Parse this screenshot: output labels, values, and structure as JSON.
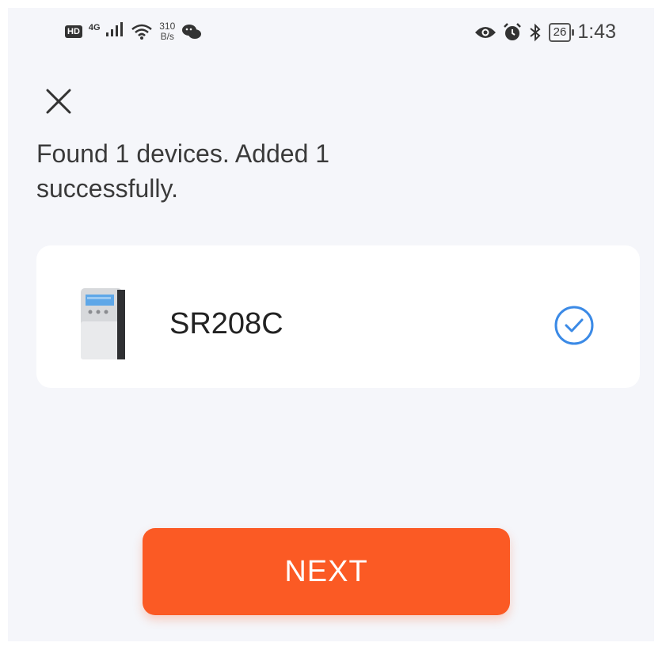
{
  "status_bar": {
    "hd_badge": "HD",
    "network": "4G",
    "speed_value": "310",
    "speed_unit": "B/s",
    "battery": "26",
    "time": "1:43",
    "icons": [
      "signal-bars-icon",
      "wifi-icon",
      "wechat-icon",
      "eye-icon",
      "alarm-icon",
      "bluetooth-icon",
      "battery-icon"
    ]
  },
  "header": {
    "close_icon": "close-icon"
  },
  "main": {
    "message": "Found 1 devices. Added 1 successfully.",
    "devices": [
      {
        "name": "SR208C",
        "status_icon": "check-circle-icon"
      }
    ]
  },
  "footer": {
    "next_label": "NEXT"
  },
  "colors": {
    "accent": "#fb5a24",
    "check": "#3b8ae6",
    "background": "#f5f6fa",
    "card": "#ffffff"
  }
}
